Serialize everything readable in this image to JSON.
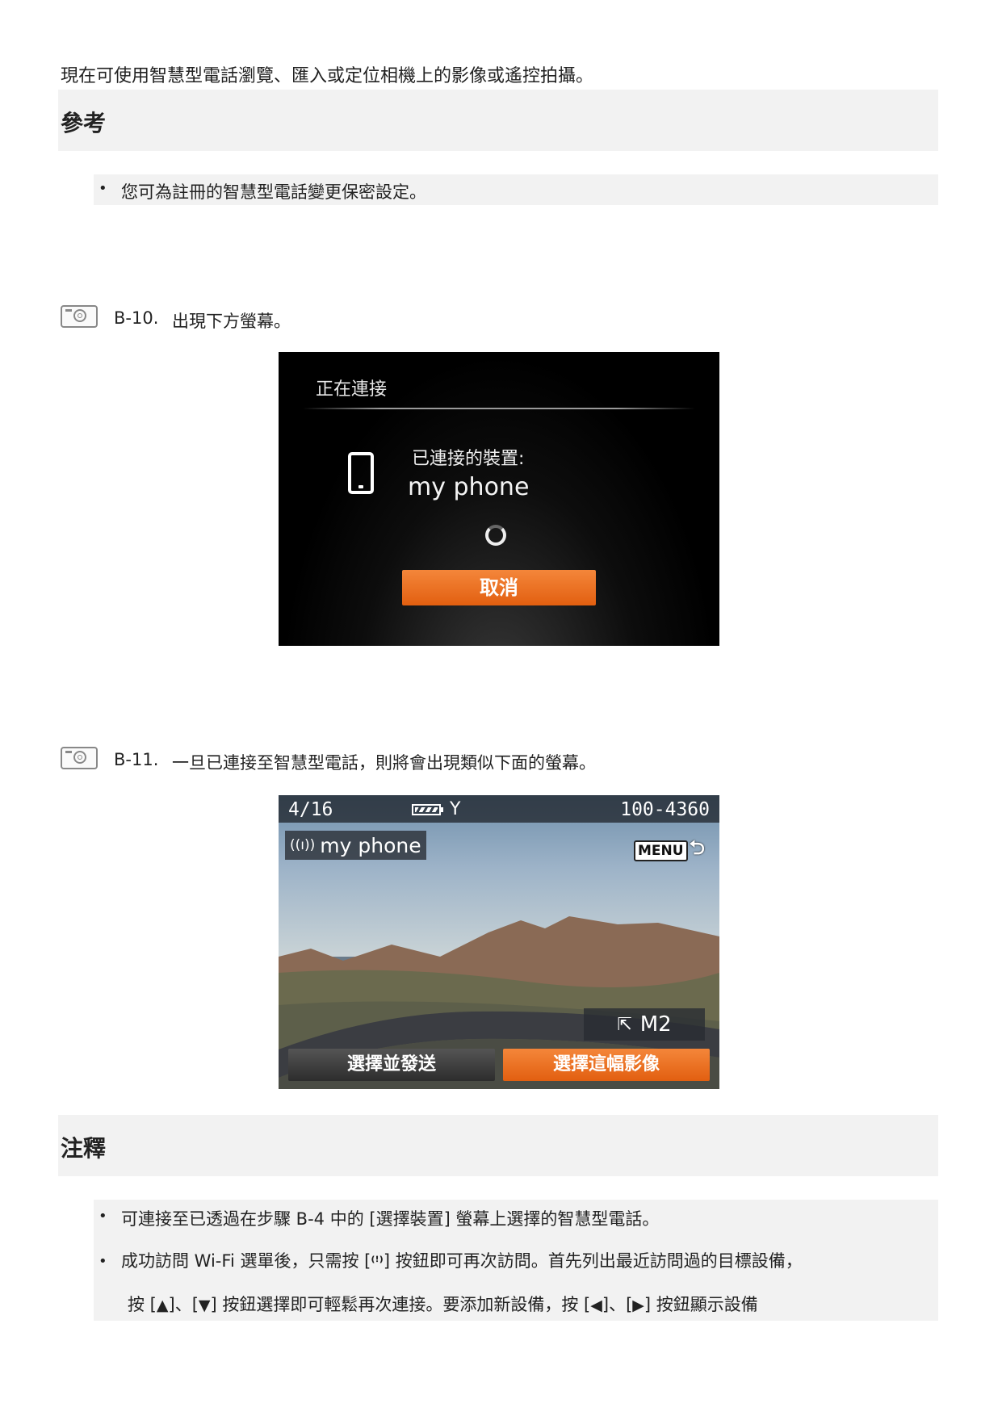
{
  "intro_text": "現在可使用智慧型電話瀏覽、匯入或定位相機上的影像或遙控拍攝。",
  "reference": {
    "title": "參考",
    "items": [
      "您可為註冊的智慧型電話變更保密設定。"
    ]
  },
  "step_b10": {
    "number": "B-10.",
    "text": "出現下方螢幕。"
  },
  "screen_connecting": {
    "title": "正在連接",
    "device_label": "已連接的裝置:",
    "device_name": "my phone",
    "cancel_label": "取消"
  },
  "step_b11": {
    "number": "B-11.",
    "text": "一旦已連接至智慧型電話，則將會出現類似下面的螢幕。"
  },
  "screen_connected": {
    "image_count": "4/16",
    "file_number": "100-4360",
    "device_name": "my phone",
    "menu_label": "MENU",
    "resize_label": "M2",
    "button_select_send": "選擇並發送",
    "button_select_this": "選擇這幅影像"
  },
  "notes": {
    "title": "注釋",
    "item1": "可連接至已透過在步驟 B-4 中的 [選擇裝置] 螢幕上選擇的智慧型電話。",
    "item2_a": "成功訪問 Wi-Fi 選單後，只需按 [",
    "item2_b": "] 按鈕即可再次訪問。首先列出最近訪問過的目標設備，",
    "item2_c": "按 [",
    "item2_d": "]、[",
    "item2_e": "] 按鈕選擇即可輕鬆再次連接。要添加新設備，按 [",
    "item2_f": "]、[",
    "item2_g": "] 按鈕顯示設備"
  }
}
